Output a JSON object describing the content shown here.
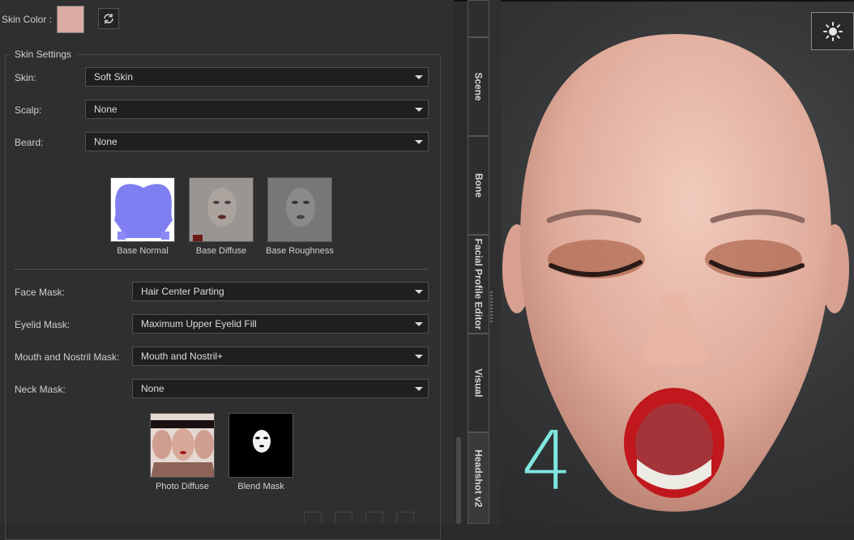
{
  "skin_color": {
    "label": "Skin Color :",
    "swatch_color": "#dcaca2"
  },
  "skin_settings": {
    "legend": "Skin Settings",
    "skin": {
      "label": "Skin:",
      "value": "Soft Skin"
    },
    "scalp": {
      "label": "Scalp:",
      "value": "None"
    },
    "beard": {
      "label": "Beard:",
      "value": "None"
    },
    "textures": [
      {
        "label": "Base Normal",
        "icon": "normal-map-thumbnail"
      },
      {
        "label": "Base Diffuse",
        "icon": "diffuse-map-thumbnail"
      },
      {
        "label": "Base Roughness",
        "icon": "roughness-map-thumbnail"
      }
    ],
    "face_mask": {
      "label": "Face Mask:",
      "value": "Hair Center Parting"
    },
    "eyelid_mask": {
      "label": "Eyelid Mask:",
      "value": "Maximum Upper Eyelid Fill"
    },
    "mouth_mask": {
      "label": "Mouth and Nostril Mask:",
      "value": "Mouth and Nostril+"
    },
    "neck_mask": {
      "label": "Neck Mask:",
      "value": "None"
    },
    "mask_textures": [
      {
        "label": "Photo Diffuse",
        "icon": "photo-diffuse-thumbnail"
      },
      {
        "label": "Blend Mask",
        "icon": "blend-mask-thumbnail"
      }
    ]
  },
  "side_tabs": [
    "Scene",
    "Bone",
    "Facial Profile Editor",
    "Visual",
    "Headshot v2"
  ],
  "viewport": {
    "overlay_number": "4",
    "accent_color": "#7fe6e0"
  }
}
